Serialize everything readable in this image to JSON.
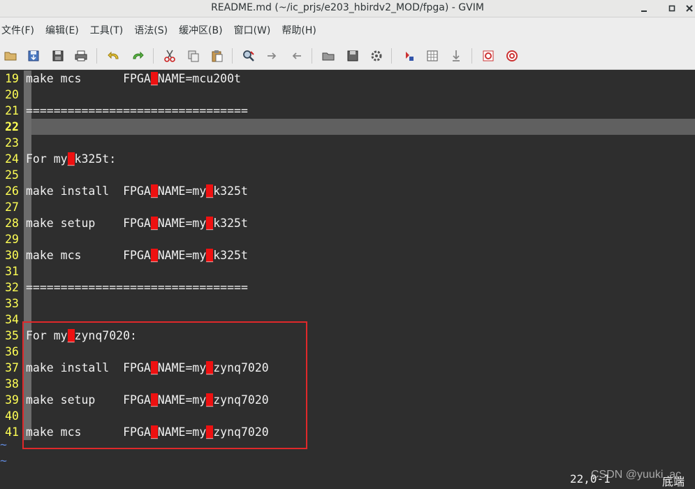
{
  "window": {
    "title": "README.md (~/ic_prjs/e203_hbirdv2_MOD/fpga) - GVIM",
    "controls": [
      "minimize-icon",
      "maximize-icon",
      "close-icon"
    ]
  },
  "menu": [
    "文件(F)",
    "编辑(E)",
    "工具(T)",
    "语法(S)",
    "缓冲区(B)",
    "窗口(W)",
    "帮助(H)"
  ],
  "toolbar": [
    "open-icon",
    "save-icon",
    "save-all-icon",
    "print-icon",
    "undo-icon",
    "redo-icon",
    "cut-icon",
    "copy-icon",
    "paste-icon",
    "find-replace-icon",
    "find-next-icon",
    "find-prev-icon",
    "load-session-icon",
    "save-session-icon",
    "run-script-icon",
    "make-icon",
    "run-shell-icon",
    "tag-jump-icon",
    "help-icon",
    "find-help-icon"
  ],
  "editor": {
    "lines": [
      {
        "num": "19",
        "segs": [
          {
            "t": "make mcs      FPGA"
          },
          {
            "t": "_",
            "err": true
          },
          {
            "t": "NAME=mcu200t"
          }
        ]
      },
      {
        "num": "20",
        "segs": []
      },
      {
        "num": "21",
        "segs": [
          {
            "t": "================================"
          }
        ]
      },
      {
        "num": "22",
        "segs": [],
        "current": true
      },
      {
        "num": "23",
        "segs": []
      },
      {
        "num": "24",
        "segs": [
          {
            "t": "For my"
          },
          {
            "t": "_",
            "err": true
          },
          {
            "t": "k325t:"
          }
        ]
      },
      {
        "num": "25",
        "segs": []
      },
      {
        "num": "26",
        "segs": [
          {
            "t": "make install  FPGA"
          },
          {
            "t": "_",
            "err": true
          },
          {
            "t": "NAME=my"
          },
          {
            "t": "_",
            "err": true
          },
          {
            "t": "k325t"
          }
        ]
      },
      {
        "num": "27",
        "segs": []
      },
      {
        "num": "28",
        "segs": [
          {
            "t": "make setup    FPGA"
          },
          {
            "t": "_",
            "err": true
          },
          {
            "t": "NAME=my"
          },
          {
            "t": "_",
            "err": true
          },
          {
            "t": "k325t"
          }
        ]
      },
      {
        "num": "29",
        "segs": []
      },
      {
        "num": "30",
        "segs": [
          {
            "t": "make mcs      FPGA"
          },
          {
            "t": "_",
            "err": true
          },
          {
            "t": "NAME=my"
          },
          {
            "t": "_",
            "err": true
          },
          {
            "t": "k325t"
          }
        ]
      },
      {
        "num": "31",
        "segs": []
      },
      {
        "num": "32",
        "segs": [
          {
            "t": "================================"
          }
        ]
      },
      {
        "num": "33",
        "segs": []
      },
      {
        "num": "34",
        "segs": []
      },
      {
        "num": "35",
        "segs": [
          {
            "t": "For my"
          },
          {
            "t": "_",
            "err": true
          },
          {
            "t": "zynq7020:"
          }
        ]
      },
      {
        "num": "36",
        "segs": []
      },
      {
        "num": "37",
        "segs": [
          {
            "t": "make install  FPGA"
          },
          {
            "t": "_",
            "err": true
          },
          {
            "t": "NAME=my"
          },
          {
            "t": "_",
            "err": true
          },
          {
            "t": "zynq7020"
          }
        ]
      },
      {
        "num": "38",
        "segs": []
      },
      {
        "num": "39",
        "segs": [
          {
            "t": "make setup    FPGA"
          },
          {
            "t": "_",
            "err": true
          },
          {
            "t": "NAME=my"
          },
          {
            "t": "_",
            "err": true
          },
          {
            "t": "zynq7020"
          }
        ]
      },
      {
        "num": "40",
        "segs": []
      },
      {
        "num": "41",
        "segs": [
          {
            "t": "make mcs      FPGA"
          },
          {
            "t": "_",
            "err": true
          },
          {
            "t": "NAME=my"
          },
          {
            "t": "_",
            "err": true
          },
          {
            "t": "zynq7020"
          }
        ]
      }
    ],
    "tildes": [
      "~",
      "~"
    ]
  },
  "status": {
    "ruler": "22,0-1",
    "position": "底端"
  },
  "watermark": "CSDN @yuuki_ac",
  "colors": {
    "background": "#2e2e2e",
    "line_number": "#ffff55",
    "error_highlight": "#ee1111",
    "cursorline": "#606060",
    "annotation_box": "#e0282a",
    "tilde": "#5f87d7"
  }
}
